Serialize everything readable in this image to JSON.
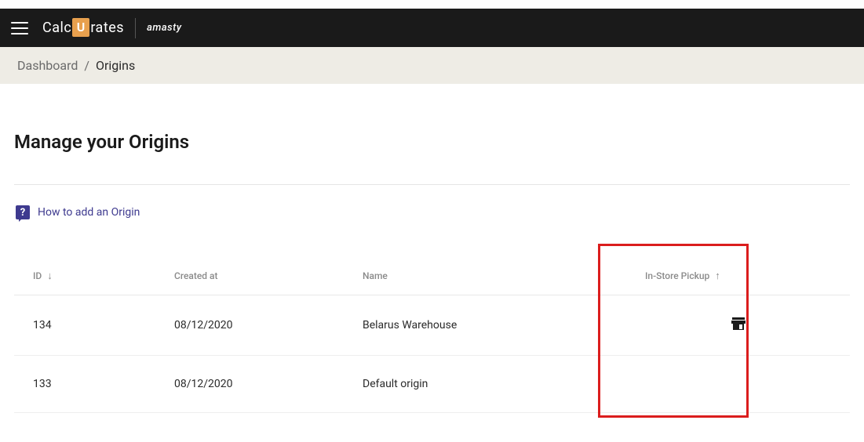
{
  "header": {
    "logo_prefix": "Calc",
    "logo_u": "U",
    "logo_suffix": "rates",
    "brand": "amasty"
  },
  "breadcrumb": {
    "parent": "Dashboard",
    "separator": "/",
    "current": "Origins"
  },
  "page": {
    "title": "Manage your Origins",
    "help_link": "How to add an Origin",
    "help_icon": "?"
  },
  "table": {
    "columns": {
      "id": "ID",
      "created_at": "Created at",
      "name": "Name",
      "in_store_pickup": "In-Store Pickup"
    },
    "sort_indicators": {
      "id": "↓",
      "pickup": "↑"
    },
    "rows": [
      {
        "id": "134",
        "created_at": "08/12/2020",
        "name": "Belarus Warehouse",
        "in_store_pickup": true
      },
      {
        "id": "133",
        "created_at": "08/12/2020",
        "name": "Default origin",
        "in_store_pickup": false
      }
    ]
  }
}
